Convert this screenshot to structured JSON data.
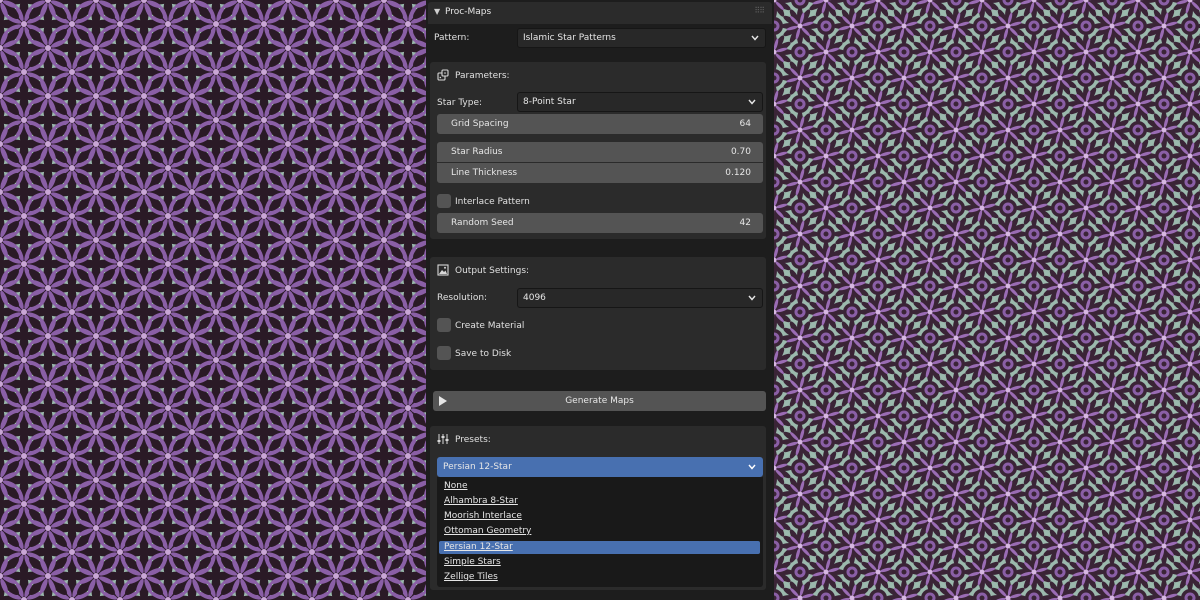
{
  "panel": {
    "title": "Proc-Maps",
    "pattern_label": "Pattern:",
    "pattern_value": "Islamic Star Patterns"
  },
  "parameters": {
    "title": "Parameters:",
    "star_type_label": "Star Type:",
    "star_type_value": "8-Point Star",
    "grid_spacing": {
      "label": "Grid Spacing",
      "value": "64"
    },
    "star_radius": {
      "label": "Star Radius",
      "value": "0.70"
    },
    "line_thickness": {
      "label": "Line Thickness",
      "value": "0.120"
    },
    "interlace": {
      "label": "Interlace Pattern",
      "checked": false
    },
    "random_seed": {
      "label": "Random Seed",
      "value": "42"
    }
  },
  "output": {
    "title": "Output Settings:",
    "resolution_label": "Resolution:",
    "resolution_value": "4096",
    "create_material": {
      "label": "Create Material",
      "checked": false
    },
    "save_to_disk": {
      "label": "Save to Disk",
      "checked": false
    }
  },
  "generate": {
    "label": "Generate Maps"
  },
  "presets": {
    "title": "Presets:",
    "selected": "Persian 12-Star",
    "options": [
      "None",
      "Alhambra 8-Star",
      "Moorish Interlace",
      "Ottoman Geometry",
      "Persian 12-Star",
      "Simple Stars",
      "Zellige Tiles"
    ]
  },
  "colors": {
    "texture_background": "#9bb9ad",
    "petal_purple": "#8a5fa6",
    "petal_dark": "#2a1a26",
    "accent_blue": "#4870b0"
  },
  "icons": {
    "header_toggle": "disclosure-triangle-down-icon",
    "parameters": "dice-icon",
    "output": "image-icon",
    "generate": "play-icon",
    "presets": "sliders-icon"
  }
}
